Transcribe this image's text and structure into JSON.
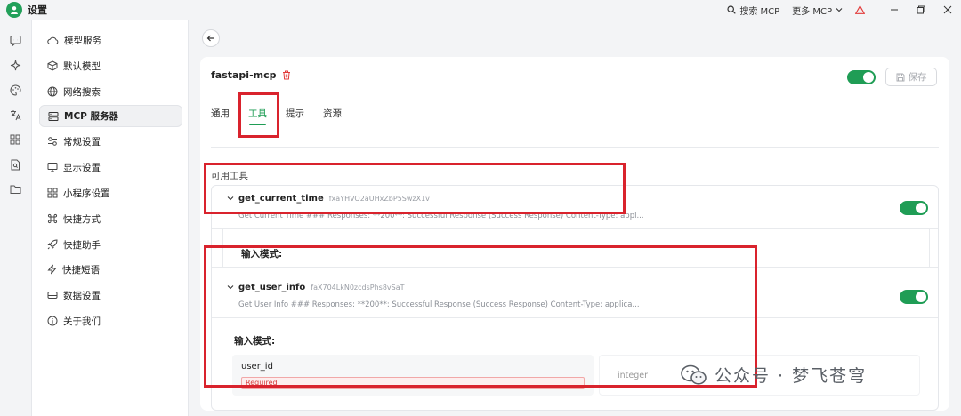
{
  "titlebar": {
    "app_title": "设置",
    "search_mcp_label": "搜索 MCP",
    "more_mcp_label": "更多 MCP"
  },
  "sidebar": {
    "items": [
      {
        "label": "模型服务",
        "icon": "cloud-icon"
      },
      {
        "label": "默认模型",
        "icon": "cube-icon"
      },
      {
        "label": "网络搜索",
        "icon": "globe-icon"
      },
      {
        "label": "MCP 服务器",
        "icon": "server-icon",
        "active": true
      },
      {
        "label": "常规设置",
        "icon": "sliders-icon"
      },
      {
        "label": "显示设置",
        "icon": "monitor-icon"
      },
      {
        "label": "小程序设置",
        "icon": "grid-icon"
      },
      {
        "label": "快捷方式",
        "icon": "command-icon"
      },
      {
        "label": "快捷助手",
        "icon": "rocket-icon"
      },
      {
        "label": "快捷短语",
        "icon": "zap-icon"
      },
      {
        "label": "数据设置",
        "icon": "database-icon"
      },
      {
        "label": "关于我们",
        "icon": "info-icon"
      }
    ]
  },
  "server": {
    "name": "fastapi-mcp",
    "save_label": "保存",
    "enabled": true
  },
  "tabs": [
    {
      "label": "通用",
      "active": false
    },
    {
      "label": "工具",
      "active": true
    },
    {
      "label": "提示",
      "active": false
    },
    {
      "label": "资源",
      "active": false
    }
  ],
  "tools_section_label": "可用工具",
  "tools": [
    {
      "name": "get_current_time",
      "id": "fxaYHVO2aUHxZbP5SwzX1v",
      "description": "Get Current Time ### Responses: **200**: Successful Response (Success Response) Content-Type: appl...",
      "enabled": true,
      "schema_title": "输入模式:"
    },
    {
      "name": "get_user_info",
      "id": "faX704LkN0zcdsPhs8vSaT",
      "description": "Get User Info ### Responses: **200**: Successful Response (Success Response) Content-Type: applica...",
      "enabled": true,
      "schema_title": "输入模式:",
      "params": [
        {
          "name": "user_id",
          "required_label": "Required",
          "type": "integer"
        }
      ]
    }
  ],
  "watermark": "公众号 · 梦飞苍穹",
  "colors": {
    "accent": "#1f9d55",
    "highlight": "#d9232d",
    "required_bg": "#fdeeee",
    "required_text": "#d63b3b"
  }
}
